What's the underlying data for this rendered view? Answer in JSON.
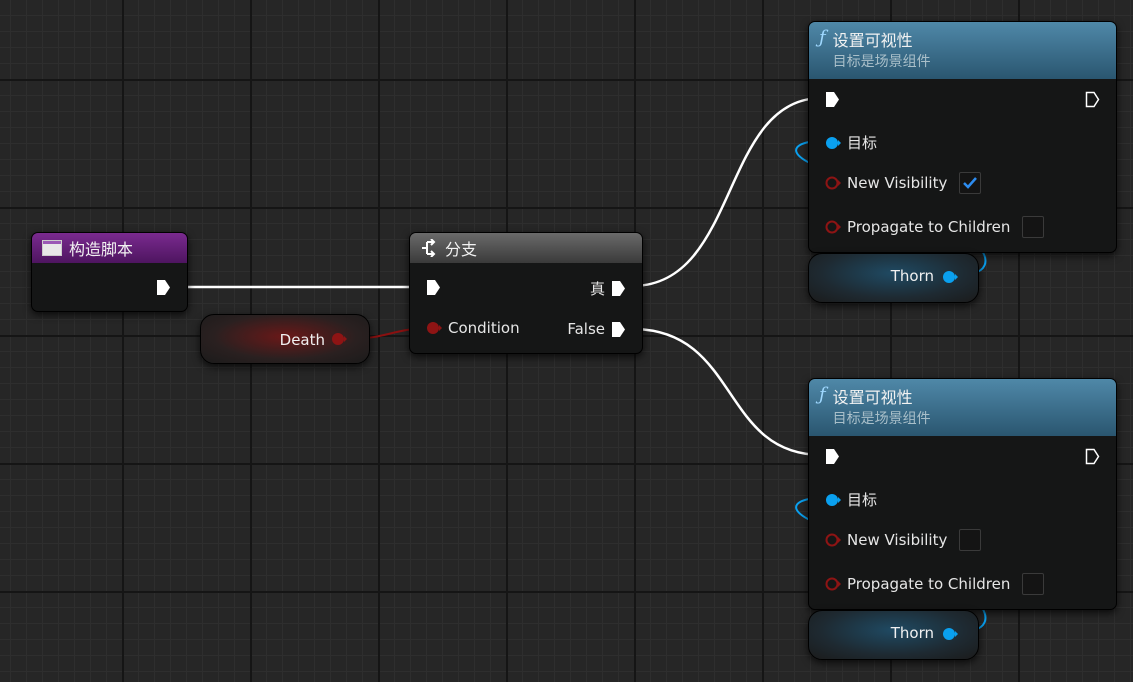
{
  "nodes": {
    "construction": {
      "title": "构造脚本"
    },
    "branch": {
      "title": "分支",
      "condition_label": "Condition",
      "true_label": "真",
      "false_label": "False"
    },
    "set_vis_1": {
      "title": "设置可视性",
      "subtitle": "目标是场景组件",
      "target_label": "目标",
      "visibility_label": "New Visibility",
      "visibility_checked": true,
      "propagate_label": "Propagate to Children",
      "propagate_checked": false
    },
    "set_vis_2": {
      "title": "设置可视性",
      "subtitle": "目标是场景组件",
      "target_label": "目标",
      "visibility_label": "New Visibility",
      "visibility_checked": false,
      "propagate_label": "Propagate to Children",
      "propagate_checked": false
    },
    "death_var": {
      "label": "Death"
    },
    "thorn_var_1": {
      "label": "Thorn"
    },
    "thorn_var_2": {
      "label": "Thorn"
    }
  },
  "colors": {
    "exec": "#ffffff",
    "bool": "#8e1414",
    "object": "#0aa0ef",
    "construction_header": "#6a1f7d",
    "function_header": "#3f6f8c"
  },
  "icons": {
    "construction": "script-icon",
    "branch": "branch-icon",
    "function": "function-icon",
    "check": "check-icon"
  }
}
